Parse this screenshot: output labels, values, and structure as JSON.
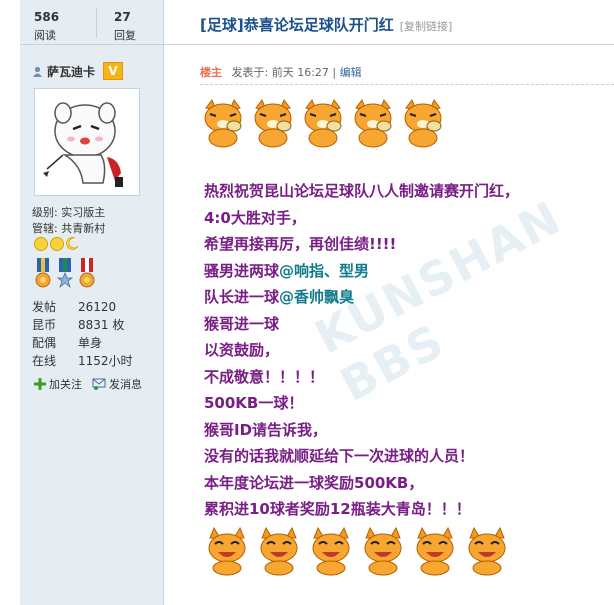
{
  "stats": {
    "views_count": "586",
    "views_label": "阅读",
    "replies_count": "27",
    "replies_label": "回复"
  },
  "author": {
    "name": "萨瓦迪卡",
    "badge": "V"
  },
  "meta": {
    "level": "级别: 实习版主",
    "manage": "管辖: 共青新村"
  },
  "profile": [
    {
      "key": "发帖",
      "value": "26120"
    },
    {
      "key": "昆币",
      "value": "8831 枚"
    },
    {
      "key": "配偶",
      "value": "单身"
    },
    {
      "key": "在线",
      "value": "1152小时"
    }
  ],
  "actions": {
    "follow": "加关注",
    "message": "发消息"
  },
  "thread": {
    "title": "[足球]恭喜论坛足球队开门红",
    "copy_link": "[复制链接]"
  },
  "post": {
    "owner": "楼主",
    "posted": "发表于: 前天 16:27",
    "sep": " | ",
    "edit": "编辑"
  },
  "content": {
    "line1": "热烈祝贺昆山论坛足球队八人制邀请赛开门红，",
    "line2": "4:0大胜对手，",
    "line3": "希望再接再厉，再创佳绩!!!!",
    "line4a": "骚男进两球",
    "line4b": "@响指、型男",
    "line5a": "队长进一球",
    "line5b": "@香帅飘臭",
    "line6": "猴哥进一球",
    "line7": "以资鼓励，",
    "line8": "不成敬意！！！！",
    "line9": "500KB一球！",
    "line10": "猴哥ID请告诉我，",
    "line11": "没有的话我就顺延给下一次进球的人员！",
    "line12": "本年度论坛进一球奖励500KB，",
    "line13": "累积进10球者奖励12瓶装大青岛！！！"
  },
  "watermark": "KUNSHAN BBS",
  "colors": {
    "accent": "#1b4f8e",
    "content_purple": "#7a1e87",
    "content_teal": "#117b8b",
    "sidebar_bg": "#e5edf2"
  }
}
